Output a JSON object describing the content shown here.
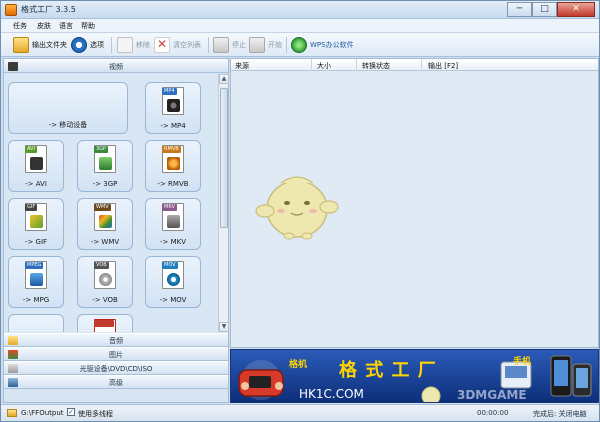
{
  "window": {
    "title": "格式工厂 3.3.5",
    "btn_min": "─",
    "btn_max": "□",
    "btn_close": "✕"
  },
  "menu": [
    "任务",
    "皮肤",
    "语言",
    "帮助"
  ],
  "toolbar": {
    "output_folder": "输出文件夹",
    "options": "选项",
    "remove": "移除",
    "clear_list": "清空列表",
    "stop": "停止",
    "start": "开始",
    "wps": "WPS办公软件"
  },
  "categories": {
    "video": "视频",
    "audio": "音频",
    "image": "图片",
    "rom": "光驱设备\\DVD\\CD\\ISO",
    "advanced": "高级"
  },
  "tiles": [
    {
      "label": "-> 移动设备",
      "tag": ""
    },
    {
      "label": "-> MP4",
      "tag": "MP4"
    },
    {
      "label": "-> AVI",
      "tag": "AVI"
    },
    {
      "label": "-> 3GP",
      "tag": "3GP"
    },
    {
      "label": "-> RMVB",
      "tag": "RMVB"
    },
    {
      "label": "-> GIF",
      "tag": "GIF"
    },
    {
      "label": "-> WMV",
      "tag": "WMV"
    },
    {
      "label": "-> MKV",
      "tag": "MKV"
    },
    {
      "label": "-> MPG",
      "tag": "MPEG"
    },
    {
      "label": "-> VOB",
      "tag": "VOB"
    },
    {
      "label": "-> MOV",
      "tag": "MOV"
    }
  ],
  "columns": [
    "来源",
    "大小",
    "转换状态",
    "输出 [F2]"
  ],
  "banner": {
    "left_label": "格机",
    "brand": "格 式 工 厂",
    "sub": "HK1C.COM",
    "right_label": "手机",
    "watermark": "3DMGAME"
  },
  "status": {
    "path": "G:\\FFOutput",
    "multithread_label": "使用多线程",
    "elapsed": "00:00:00",
    "right": "完成后: 关闭电脑"
  },
  "colors": {
    "accent": "#2c78c9",
    "banner": "#1a46a0",
    "brand_text": "#ffd400"
  }
}
